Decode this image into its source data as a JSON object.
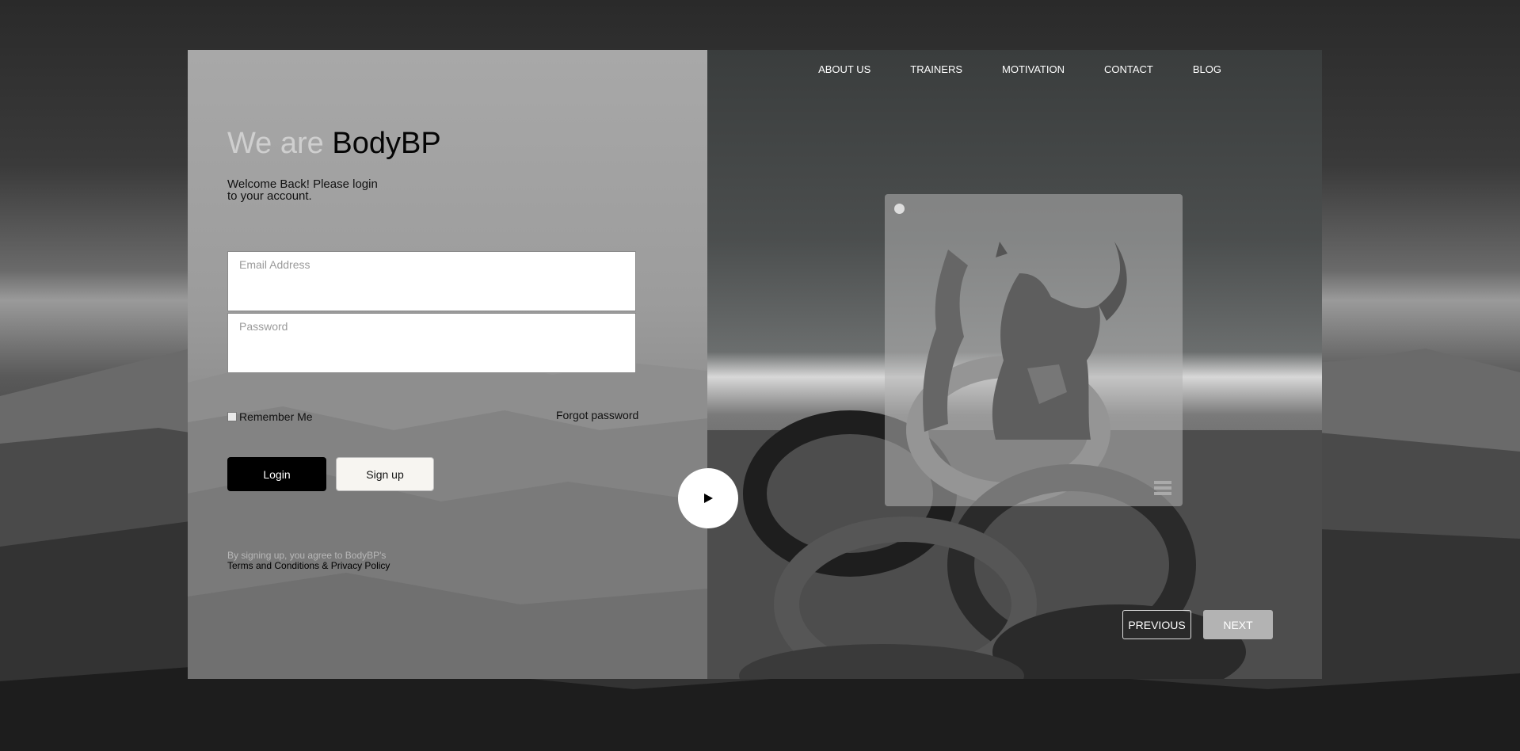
{
  "brand": {
    "heading_light": "We are",
    "heading_dark": "BodyBP"
  },
  "login": {
    "welcome": "Welcome Back! Please login to your account.",
    "email_placeholder": "Email Address",
    "password_placeholder": "Password",
    "remember_label": "Remember Me",
    "forgot_label": "Forgot password",
    "login_label": "Login",
    "signup_label": "Sign up",
    "terms_line1": "By signing up, you agree to BodyBP's",
    "terms_line2": "Terms and Conditions & Privacy Policy"
  },
  "nav": {
    "items": [
      {
        "label": "ABOUT US"
      },
      {
        "label": "TRAINERS"
      },
      {
        "label": "MOTIVATION"
      },
      {
        "label": "CONTACT"
      },
      {
        "label": "BLOG"
      }
    ]
  },
  "slider": {
    "previous_label": "PREVIOUS",
    "next_label": "NEXT"
  },
  "icons": {
    "play": "play-icon",
    "logo": "bull-logo-icon",
    "menu": "menu-icon"
  }
}
